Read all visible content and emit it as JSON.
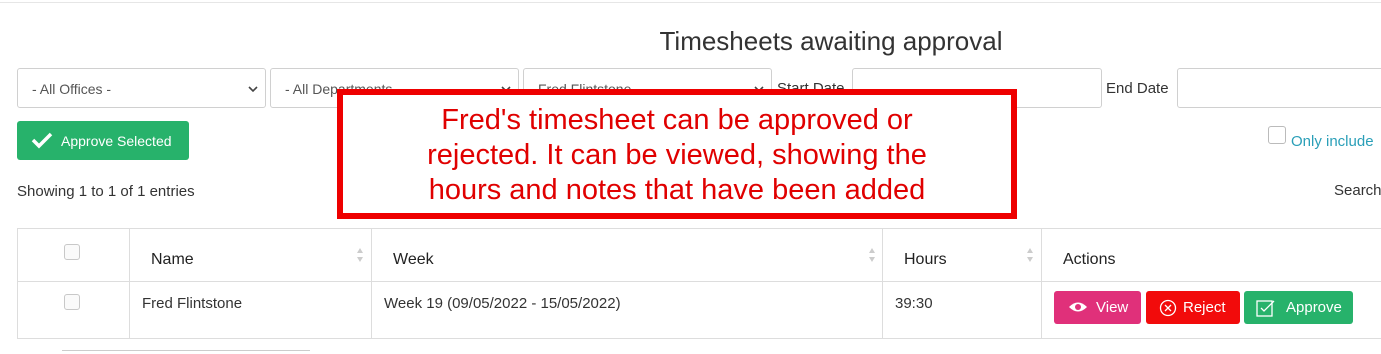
{
  "page": {
    "title": "Timesheets awaiting approval"
  },
  "filters": {
    "offices": "- All Offices -",
    "departments": "- All Departments -",
    "employee": "Fred Flintstone",
    "start_date_label": "Start Date",
    "end_date_label": "End Date"
  },
  "toolbar": {
    "approve_selected_label": "Approve Selected",
    "only_include_label": "Only include"
  },
  "listing": {
    "showing_text": "Showing 1 to 1 of 1 entries",
    "search_label": "Search"
  },
  "table": {
    "headers": [
      "Name",
      "Week",
      "Hours",
      "Actions"
    ],
    "rows": [
      {
        "name": "Fred Flintstone",
        "week": "Week 19 (09/05/2022 - 15/05/2022)",
        "hours": "39:30"
      }
    ]
  },
  "actions": {
    "view": "View",
    "reject": "Reject",
    "approve": "Approve"
  },
  "annotation": {
    "line1": "Fred's timesheet can be approved or",
    "line2": "rejected. It can be viewed, showing the",
    "line3": "hours and notes that have been added"
  },
  "colors": {
    "approve_green": "#27b26b",
    "view_pink": "#e0307a",
    "reject_red": "#f20b0b",
    "annotation_red": "#ee0000",
    "link_teal": "#2a9fb8"
  }
}
